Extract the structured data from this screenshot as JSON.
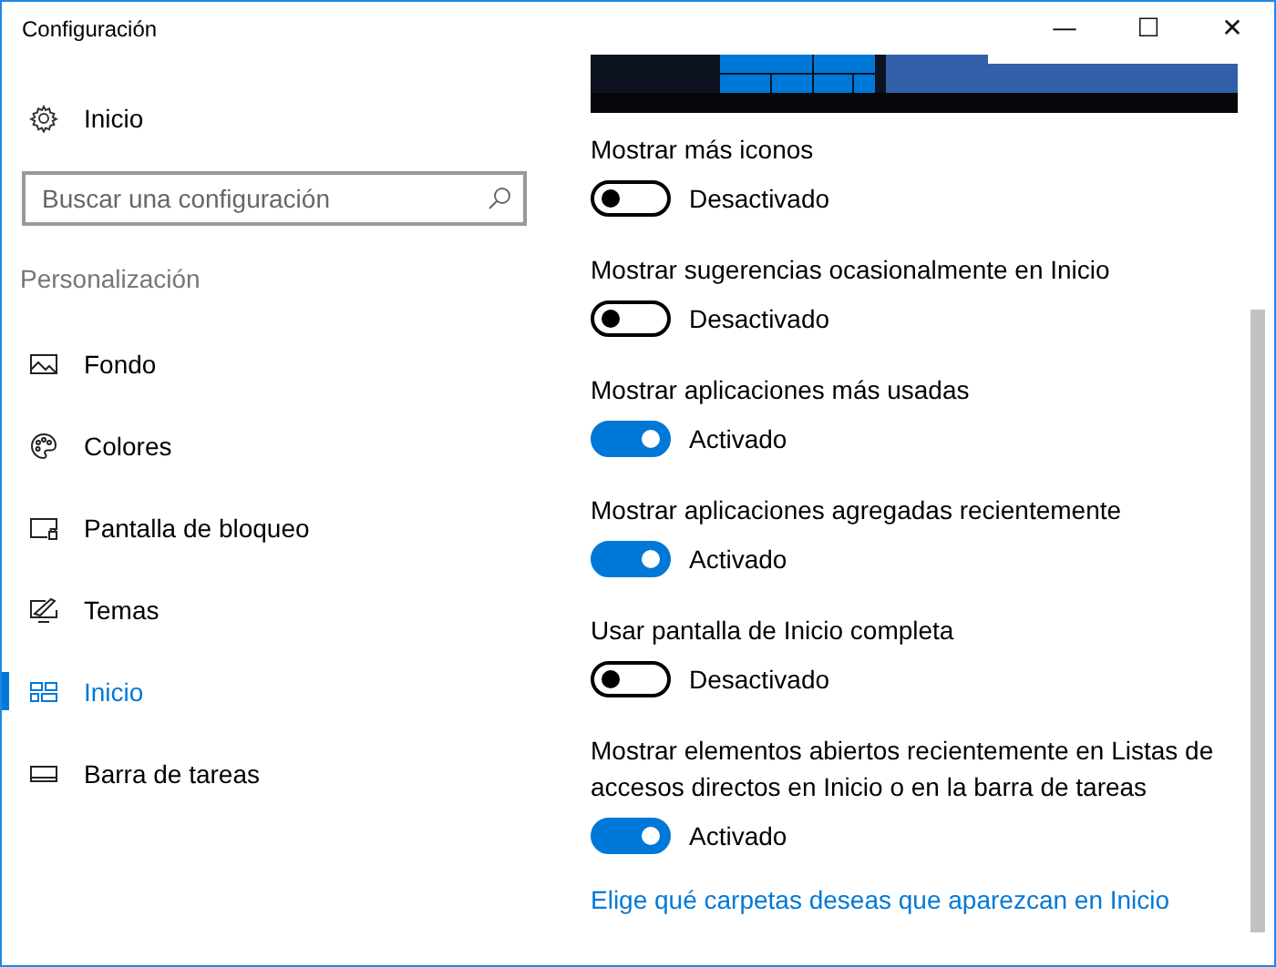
{
  "window": {
    "title": "Configuración",
    "controls": [
      "—",
      "☐",
      "✕"
    ]
  },
  "sidebar": {
    "home": "Inicio",
    "search": {
      "placeholder": "Buscar una configuración"
    },
    "section": "Personalización",
    "items": [
      {
        "label": "Fondo",
        "kind": "picture",
        "selected": false
      },
      {
        "label": "Colores",
        "kind": "palette",
        "selected": false
      },
      {
        "label": "Pantalla de bloqueo",
        "kind": "lock",
        "selected": false
      },
      {
        "label": "Temas",
        "kind": "themes",
        "selected": false
      },
      {
        "label": "Inicio",
        "kind": "start",
        "selected": true
      },
      {
        "label": "Barra de tareas",
        "kind": "taskbar",
        "selected": false
      }
    ]
  },
  "settings": [
    {
      "label": "Mostrar más iconos",
      "on": false,
      "state_text": "Desactivado"
    },
    {
      "label": "Mostrar sugerencias ocasionalmente en Inicio",
      "on": false,
      "state_text": "Desactivado"
    },
    {
      "label": "Mostrar aplicaciones más usadas",
      "on": true,
      "state_text": "Activado"
    },
    {
      "label": "Mostrar aplicaciones agregadas recientemente",
      "on": true,
      "state_text": "Activado"
    },
    {
      "label": "Usar pantalla de Inicio completa",
      "on": false,
      "state_text": "Desactivado"
    },
    {
      "label": "Mostrar elementos abiertos recientemente en Listas de accesos directos en Inicio o en la barra de tareas",
      "on": true,
      "state_text": "Activado"
    }
  ],
  "link": "Elige qué carpetas deseas que aparezcan en Inicio"
}
